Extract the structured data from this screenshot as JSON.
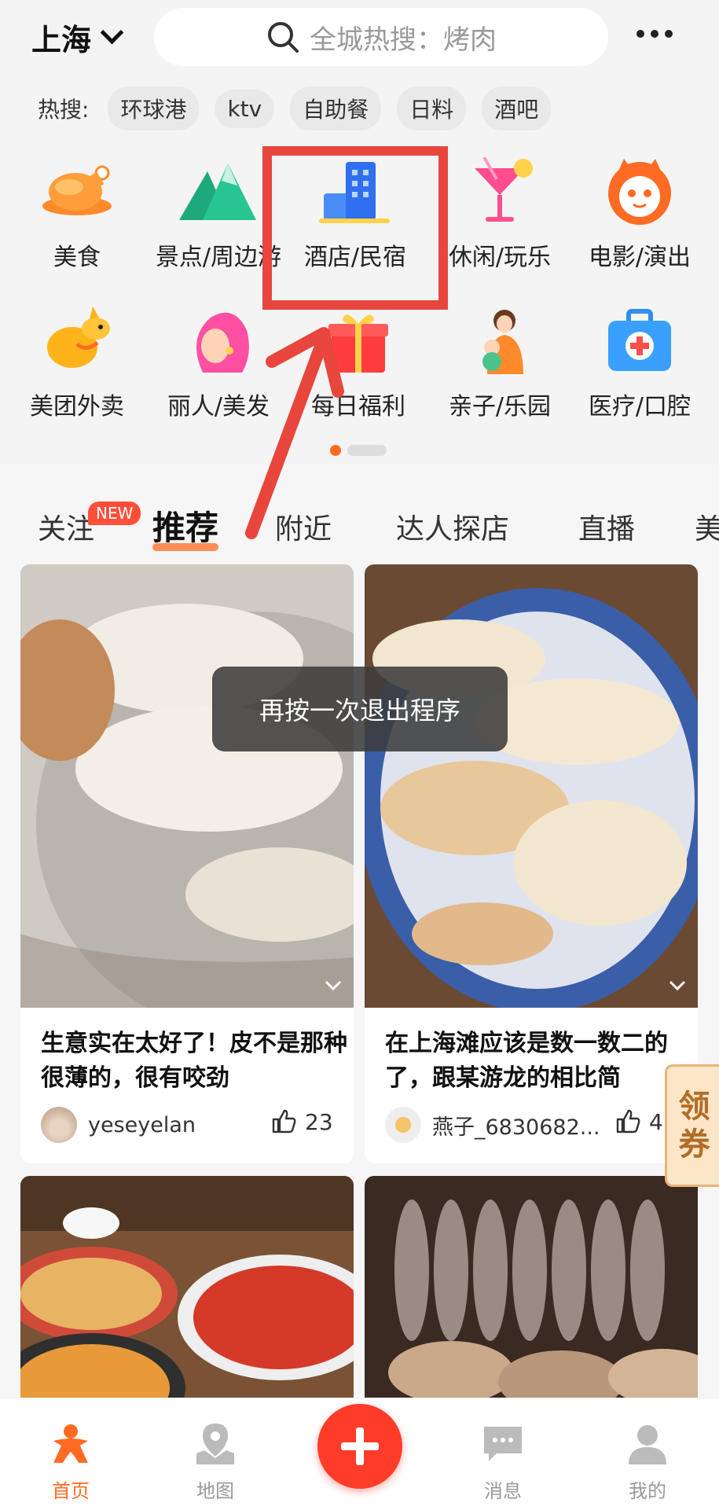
{
  "header": {
    "city": "上海",
    "search_placeholder": "全城热搜：烤肉",
    "hot_label": "热搜:",
    "hot_chips": [
      "环球港",
      "ktv",
      "自助餐",
      "日料",
      "酒吧"
    ]
  },
  "categories": [
    {
      "label": "美食",
      "icon": "roast-chicken-icon"
    },
    {
      "label": "景点/周边游",
      "icon": "mountain-icon"
    },
    {
      "label": "酒店/民宿",
      "icon": "hotel-building-icon"
    },
    {
      "label": "休闲/玩乐",
      "icon": "cocktail-icon"
    },
    {
      "label": "电影/演出",
      "icon": "cat-face-icon"
    },
    {
      "label": "美团外卖",
      "icon": "kangaroo-icon"
    },
    {
      "label": "丽人/美发",
      "icon": "woman-hair-icon"
    },
    {
      "label": "每日福利",
      "icon": "gift-box-icon"
    },
    {
      "label": "亲子/乐园",
      "icon": "mother-child-icon"
    },
    {
      "label": "医疗/口腔",
      "icon": "medical-kit-icon"
    }
  ],
  "tabs": [
    {
      "label": "关注",
      "badge": "NEW"
    },
    {
      "label": "推荐",
      "active": true
    },
    {
      "label": "附近"
    },
    {
      "label": "达人探店"
    },
    {
      "label": "直播"
    },
    {
      "label": "美"
    }
  ],
  "feed": [
    {
      "title": "生意实在太好了！皮不是那种很薄的，很有咬劲",
      "user": "yeseyelan",
      "likes": "23"
    },
    {
      "title": "在上海滩应该是数一数二的了，跟某游龙的相比简",
      "user": "燕子_6830682...",
      "likes": "45"
    }
  ],
  "toast": "再按一次退出程序",
  "coupon": [
    "领",
    "券"
  ],
  "nav": [
    {
      "label": "首页",
      "icon": "home-icon",
      "active": true
    },
    {
      "label": "地图",
      "icon": "map-pin-icon"
    },
    {
      "label": "",
      "icon": "plus-icon"
    },
    {
      "label": "消息",
      "icon": "message-icon"
    },
    {
      "label": "我的",
      "icon": "profile-icon"
    }
  ],
  "colors": {
    "accent": "#ff6b22",
    "highlight": "#e8463c",
    "plus": "#ff3c2a"
  }
}
